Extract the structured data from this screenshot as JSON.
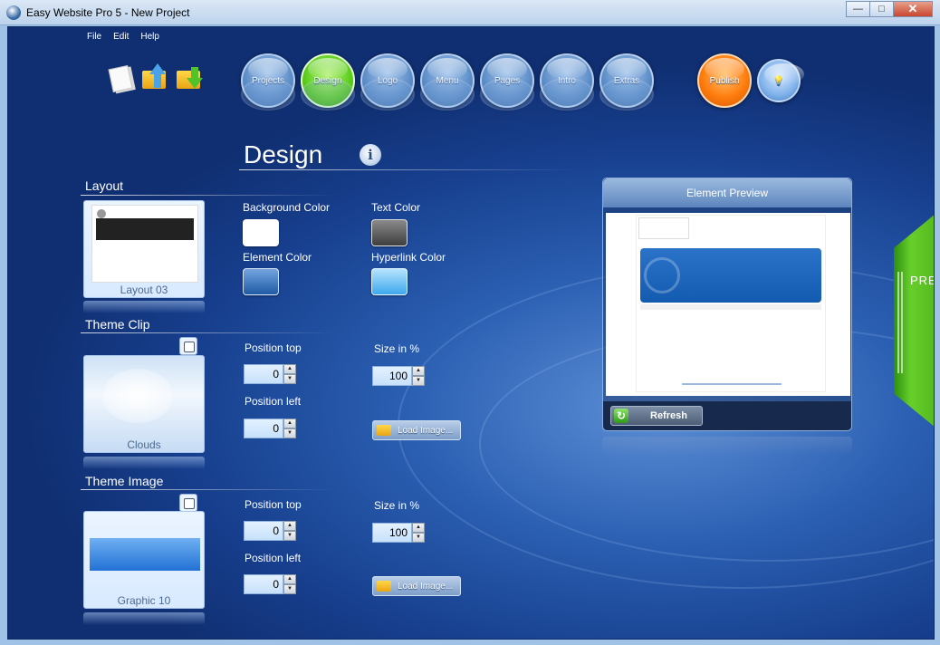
{
  "window": {
    "title": "Easy Website Pro 5 - New Project"
  },
  "menu": {
    "file": "File",
    "edit": "Edit",
    "help": "Help"
  },
  "nav": {
    "projects": "Projects",
    "design": "Design",
    "logo": "Logo",
    "menu": "Menu",
    "pages": "Pages",
    "intro": "Intro",
    "extras": "Extras",
    "publish": "Publish"
  },
  "page": {
    "title": "Design"
  },
  "layout": {
    "title": "Layout",
    "thumb_caption": "Layout 03",
    "background_color_label": "Background Color",
    "text_color_label": "Text Color",
    "element_color_label": "Element Color",
    "hyperlink_color_label": "Hyperlink Color",
    "colors": {
      "background": "#ffffff",
      "text": "#555555",
      "element": "#2f6db6",
      "hyperlink": "#5fb7f2"
    }
  },
  "theme_clip": {
    "title": "Theme Clip",
    "thumb_caption": "Clouds",
    "position_top_label": "Position top",
    "position_top_value": "0",
    "position_left_label": "Position left",
    "position_left_value": "0",
    "size_label": "Size in %",
    "size_value": "100",
    "load_button": "Load Image..."
  },
  "theme_image": {
    "title": "Theme Image",
    "thumb_caption": "Graphic 10",
    "position_top_label": "Position top",
    "position_top_value": "0",
    "position_left_label": "Position left",
    "position_left_value": "0",
    "size_label": "Size in %",
    "size_value": "100",
    "load_button": "Load Image..."
  },
  "preview": {
    "title": "Element Preview",
    "refresh_button": "Refresh",
    "side_tab": "PREVIEW"
  }
}
